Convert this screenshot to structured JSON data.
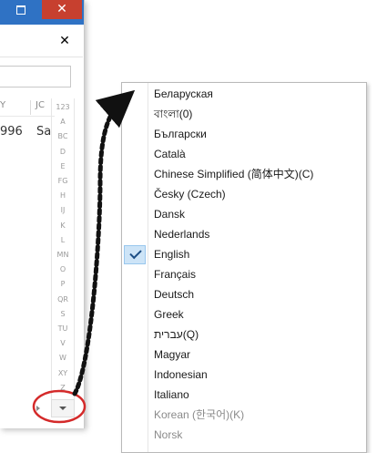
{
  "app": {
    "titlebar": {
      "restore_label": "",
      "close_label": "✕"
    },
    "pane_close": "✕",
    "columns": [
      "Y",
      "JC"
    ],
    "row_cells": [
      "996",
      "Sa"
    ],
    "alphabet": [
      "123",
      "A",
      "BC",
      "D",
      "E",
      "FG",
      "H",
      "IJ",
      "K",
      "L",
      "MN",
      "O",
      "P",
      "QR",
      "S",
      "TU",
      "V",
      "W",
      "XY",
      "Z"
    ]
  },
  "language_menu": {
    "items": [
      {
        "label": "Беларуская",
        "selected": false,
        "disabled": false
      },
      {
        "label": "বাংলা(0)",
        "selected": false,
        "disabled": false
      },
      {
        "label": "Български",
        "selected": false,
        "disabled": false
      },
      {
        "label": "Català",
        "selected": false,
        "disabled": false
      },
      {
        "label": "Chinese Simplified (简体中文)(C)",
        "selected": false,
        "disabled": false
      },
      {
        "label": "Česky (Czech)",
        "selected": false,
        "disabled": false
      },
      {
        "label": "Dansk",
        "selected": false,
        "disabled": false
      },
      {
        "label": "Nederlands",
        "selected": false,
        "disabled": false
      },
      {
        "label": "English",
        "selected": true,
        "disabled": false
      },
      {
        "label": "Français",
        "selected": false,
        "disabled": false
      },
      {
        "label": "Deutsch",
        "selected": false,
        "disabled": false
      },
      {
        "label": "Greek",
        "selected": false,
        "disabled": false
      },
      {
        "label": "עברית(Q)",
        "selected": false,
        "disabled": false
      },
      {
        "label": "Magyar",
        "selected": false,
        "disabled": false
      },
      {
        "label": "Indonesian",
        "selected": false,
        "disabled": false
      },
      {
        "label": "Italiano",
        "selected": false,
        "disabled": false
      },
      {
        "label": "Korean (한국어)(K)",
        "selected": false,
        "disabled": true
      },
      {
        "label": "Norsk",
        "selected": false,
        "disabled": true
      }
    ]
  },
  "colors": {
    "titlebar": "#2f72c4",
    "close_button": "#c7402f",
    "selection_fill": "#cde4f7",
    "annotation_red": "#d42a2a",
    "annotation_arrow": "#111111"
  },
  "icons": [
    "restore-icon",
    "close-icon",
    "check-icon",
    "chevron-down-icon"
  ]
}
